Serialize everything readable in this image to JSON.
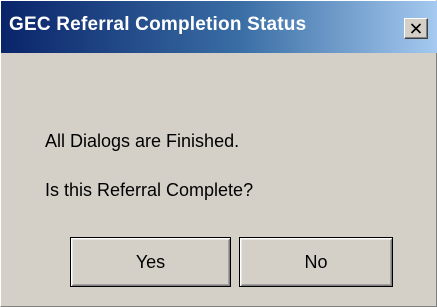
{
  "window": {
    "title": "GEC Referral Completion Status"
  },
  "messages": {
    "line1": "All Dialogs are Finished.",
    "line2": "Is this Referral Complete?"
  },
  "buttons": {
    "yes_label": "Yes",
    "no_label": "No"
  },
  "colors": {
    "titlebar_start": "#0a246a",
    "titlebar_end": "#a6caf0",
    "face": "#d4d0c8"
  }
}
